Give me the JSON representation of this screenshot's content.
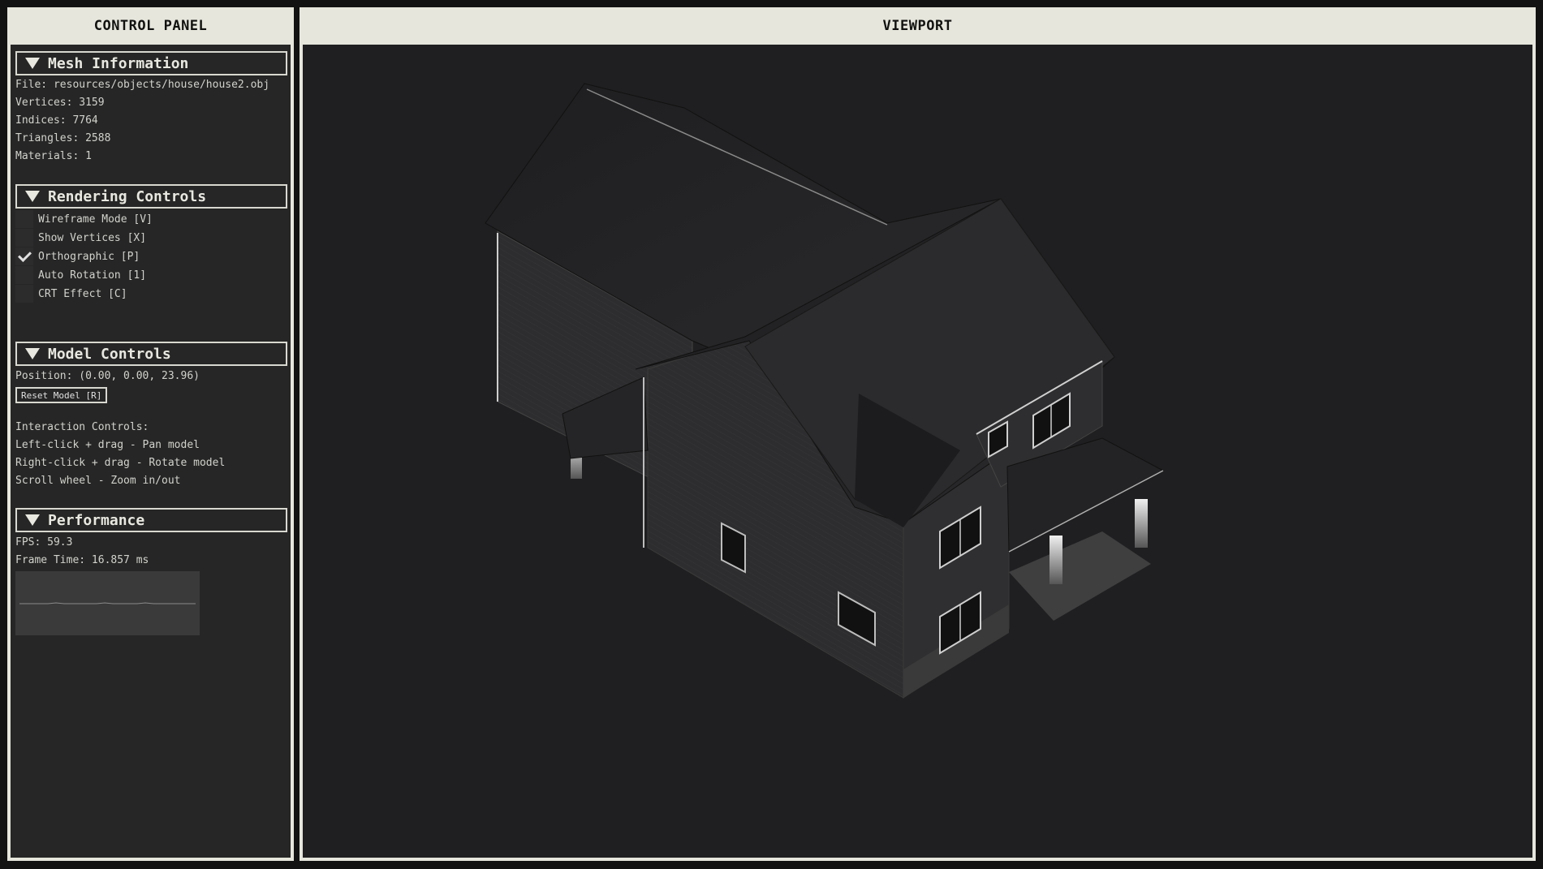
{
  "panel": {
    "title": "CONTROL PANEL",
    "mesh": {
      "header": "Mesh Information",
      "file": "File: resources/objects/house/house2.obj",
      "vertices": "Vertices: 3159",
      "indices": "Indices: 7764",
      "triangles": "Triangles: 2588",
      "materials": "Materials: 1"
    },
    "rendering": {
      "header": "Rendering Controls",
      "options": [
        {
          "label": "Wireframe Mode [V]",
          "checked": false
        },
        {
          "label": "Show Vertices [X]",
          "checked": false
        },
        {
          "label": "Orthographic [P]",
          "checked": true
        },
        {
          "label": "Auto Rotation [1]",
          "checked": false
        },
        {
          "label": "CRT Effect [C]",
          "checked": false
        }
      ]
    },
    "model": {
      "header": "Model Controls",
      "position": "Position: (0.00, 0.00, 23.96)",
      "reset_label": "Reset Model [R]",
      "interaction_title": "Interaction Controls:",
      "interactions": [
        "Left-click + drag - Pan model",
        "Right-click + drag - Rotate model",
        "Scroll wheel - Zoom in/out"
      ]
    },
    "performance": {
      "header": "Performance",
      "fps": "FPS: 59.3",
      "frame_time": "Frame Time: 16.857 ms"
    }
  },
  "viewport": {
    "title": "VIEWPORT"
  },
  "colors": {
    "frame": "#e6e6dc",
    "panel_bg": "#262626",
    "viewport_bg": "#1f1f21",
    "text": "#d2d2cc"
  }
}
